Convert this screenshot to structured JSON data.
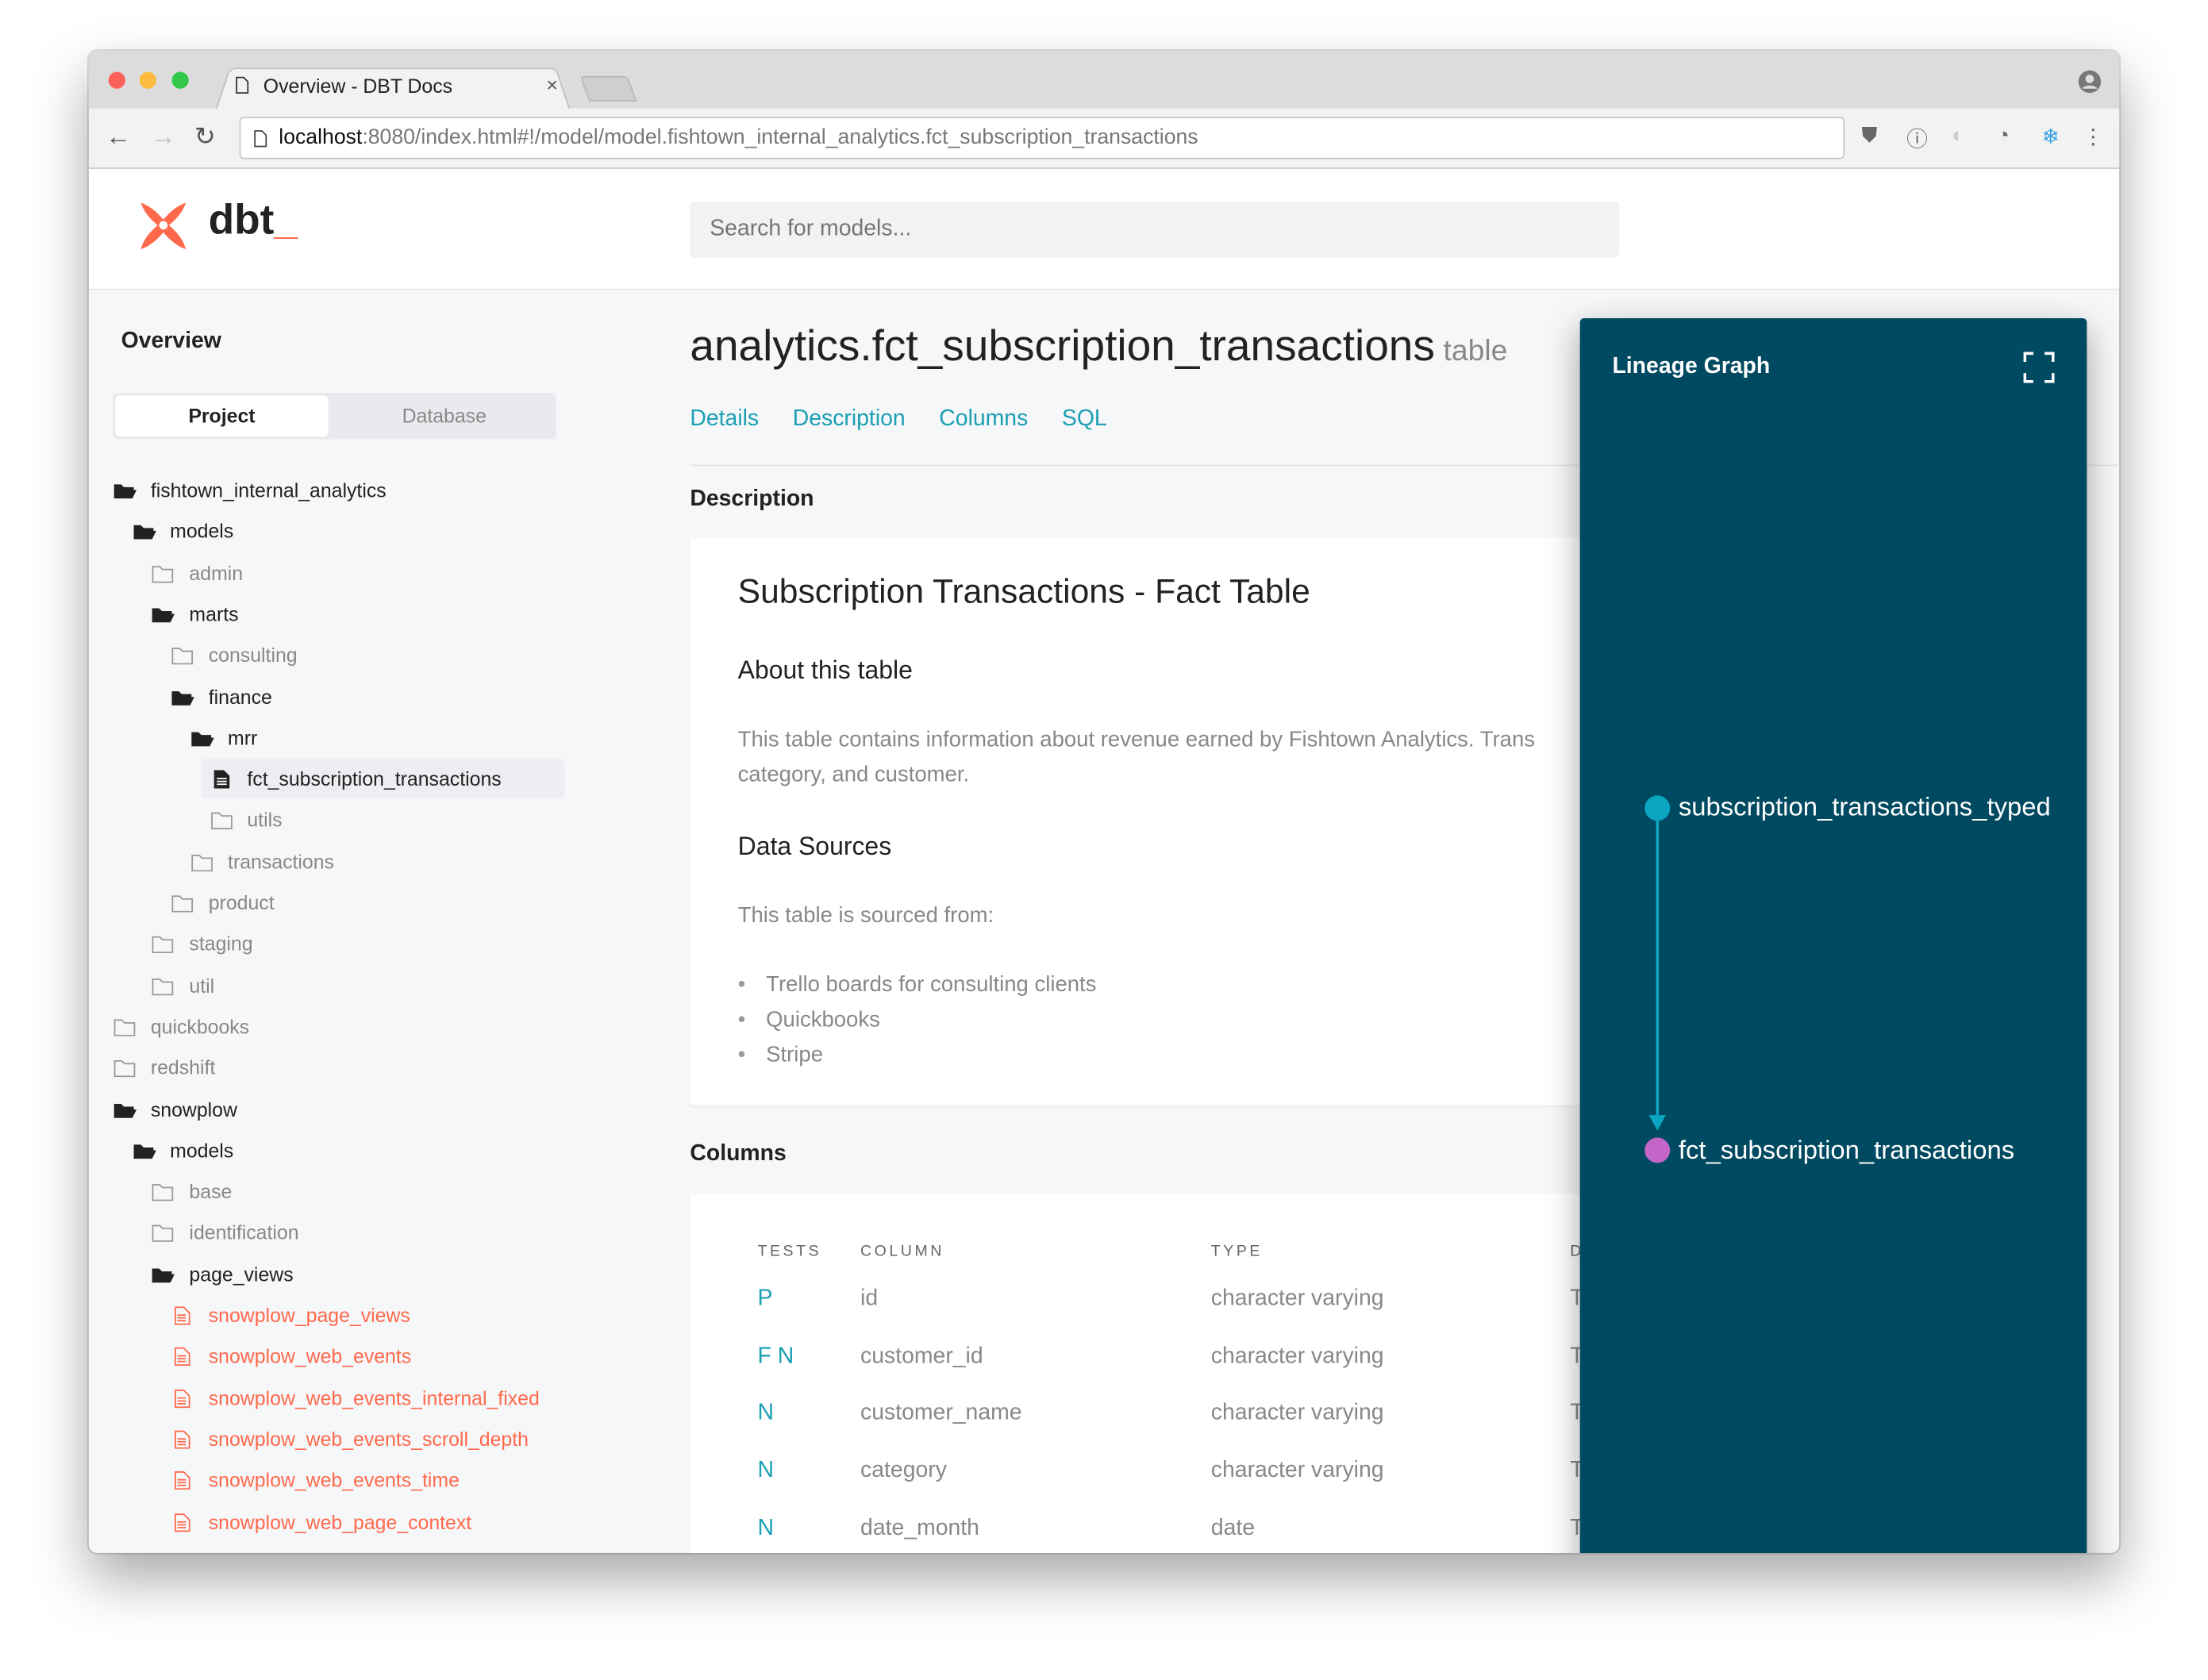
{
  "browser": {
    "tab_title": "Overview - DBT Docs",
    "tab_close": "×",
    "url_host": "localhost",
    "url_rest": ":8080/index.html#!/model/model.fishtown_internal_analytics.fct_subscription_transactions",
    "traffic_colors": [
      "#fc605b",
      "#fdbc40",
      "#34c84a"
    ]
  },
  "header": {
    "logo": "dbt",
    "logo_underscore": "_",
    "search_placeholder": "Search for models..."
  },
  "sidebar": {
    "title": "Overview",
    "toggle": {
      "project": "Project",
      "database": "Database",
      "active": "project"
    },
    "tree": [
      {
        "label": "fishtown_internal_analytics",
        "level": 0,
        "type": "folder-open"
      },
      {
        "label": "models",
        "level": 1,
        "type": "folder-open"
      },
      {
        "label": "admin",
        "level": 2,
        "type": "folder"
      },
      {
        "label": "marts",
        "level": 2,
        "type": "folder-open"
      },
      {
        "label": "consulting",
        "level": 3,
        "type": "folder"
      },
      {
        "label": "finance",
        "level": 3,
        "type": "folder-open"
      },
      {
        "label": "mrr",
        "level": 4,
        "type": "folder-open"
      },
      {
        "label": "fct_subscription_transactions",
        "level": 5,
        "type": "file",
        "selected": true
      },
      {
        "label": "utils",
        "level": 5,
        "type": "folder"
      },
      {
        "label": "transactions",
        "level": 4,
        "type": "folder"
      },
      {
        "label": "product",
        "level": 3,
        "type": "folder"
      },
      {
        "label": "staging",
        "level": 2,
        "type": "folder"
      },
      {
        "label": "util",
        "level": 2,
        "type": "folder"
      },
      {
        "label": "quickbooks",
        "level": 0,
        "type": "folder"
      },
      {
        "label": "redshift",
        "level": 0,
        "type": "folder"
      },
      {
        "label": "snowplow",
        "level": 0,
        "type": "folder-open"
      },
      {
        "label": "models",
        "level": 1,
        "type": "folder-open"
      },
      {
        "label": "base",
        "level": 2,
        "type": "folder"
      },
      {
        "label": "identification",
        "level": 2,
        "type": "folder"
      },
      {
        "label": "page_views",
        "level": 2,
        "type": "folder-open"
      },
      {
        "label": "snowplow_page_views",
        "level": 3,
        "type": "file-disabled"
      },
      {
        "label": "snowplow_web_events",
        "level": 3,
        "type": "file-disabled"
      },
      {
        "label": "snowplow_web_events_internal_fixed",
        "level": 3,
        "type": "file-disabled"
      },
      {
        "label": "snowplow_web_events_scroll_depth",
        "level": 3,
        "type": "file-disabled"
      },
      {
        "label": "snowplow_web_events_time",
        "level": 3,
        "type": "file-disabled"
      },
      {
        "label": "snowplow_web_page_context",
        "level": 3,
        "type": "file-disabled"
      }
    ]
  },
  "main": {
    "title": "analytics.fct_subscription_transactions",
    "title_type": "table",
    "tabs": [
      "Details",
      "Description",
      "Columns",
      "SQL"
    ],
    "description_label": "Description",
    "description": {
      "heading": "Subscription Transactions - Fact Table",
      "about_heading": "About this table",
      "about_text": "This table contains information about revenue earned by Fishtown Analytics. Trans",
      "about_text_2": "category, and customer.",
      "sources_heading": "Data Sources",
      "sources_intro": "This table is sourced from:",
      "sources": [
        "Trello boards for consulting clients",
        "Quickbooks",
        "Stripe"
      ]
    },
    "columns_label": "Columns",
    "columns": {
      "headers": {
        "tests": "TESTS",
        "column": "COLUMN",
        "type": "TYPE",
        "description": "D"
      },
      "rows": [
        {
          "tests": "P",
          "column": "id",
          "type": "character varying",
          "description": "T"
        },
        {
          "tests": "F N",
          "column": "customer_id",
          "type": "character varying",
          "description": "T"
        },
        {
          "tests": "N",
          "column": "customer_name",
          "type": "character varying",
          "description": "T"
        },
        {
          "tests": "N",
          "column": "category",
          "type": "character varying",
          "description": "T"
        },
        {
          "tests": "N",
          "column": "date_month",
          "type": "date",
          "description": "This column indicates ..."
        }
      ],
      "expand_glyph": "›"
    }
  },
  "lineage": {
    "title": "Lineage Graph",
    "bg_color": "#004a61",
    "nodes": [
      {
        "label": "subscription_transactions_typed",
        "color": "#0aa5c0"
      },
      {
        "label": "fct_subscription_transactions",
        "color": "#c466c8"
      }
    ],
    "edge_color": "#0aa5c0"
  }
}
